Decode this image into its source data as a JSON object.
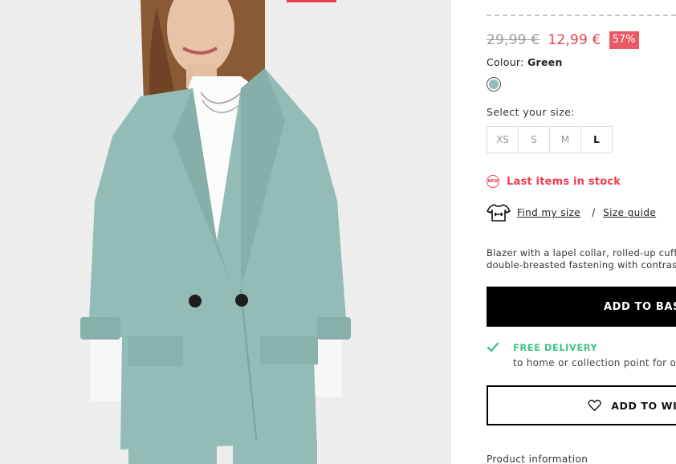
{
  "product": {
    "old_price": "29,99 €",
    "new_price": "12,99 €",
    "discount": "57%",
    "colour_label": "Colour:",
    "colour_value": "Green",
    "swatch_color": "#94bcb7",
    "size_label": "Select your size:",
    "sizes": [
      {
        "label": "XS",
        "available": false
      },
      {
        "label": "S",
        "available": false
      },
      {
        "label": "M",
        "available": false
      },
      {
        "label": "L",
        "available": true
      }
    ],
    "stock_badge": "NEW",
    "stock_text": "Last items in stock",
    "find_size": "Find my size",
    "separator": "/",
    "size_guide": "Size guide",
    "description_lines": [
      "Blazer with a lapel collar, rolled-up cuffs,",
      "double-breasted fastening with contrast b"
    ],
    "add_to_basket": "ADD TO BASI",
    "delivery_title": "FREE DELIVERY",
    "delivery_sub": "to home or collection point for or",
    "add_to_wishlist": "ADD TO WISH",
    "product_info": "Product information"
  },
  "colors": {
    "accent_red": "#e8404f",
    "delivery_green": "#3fc38e",
    "blazer": "#94bcb7"
  },
  "icons": {
    "new_badge": "new-badge-icon",
    "size_finder": "tshirt-measure-icon",
    "delivery": "check-icon",
    "wishlist": "heart-icon"
  }
}
